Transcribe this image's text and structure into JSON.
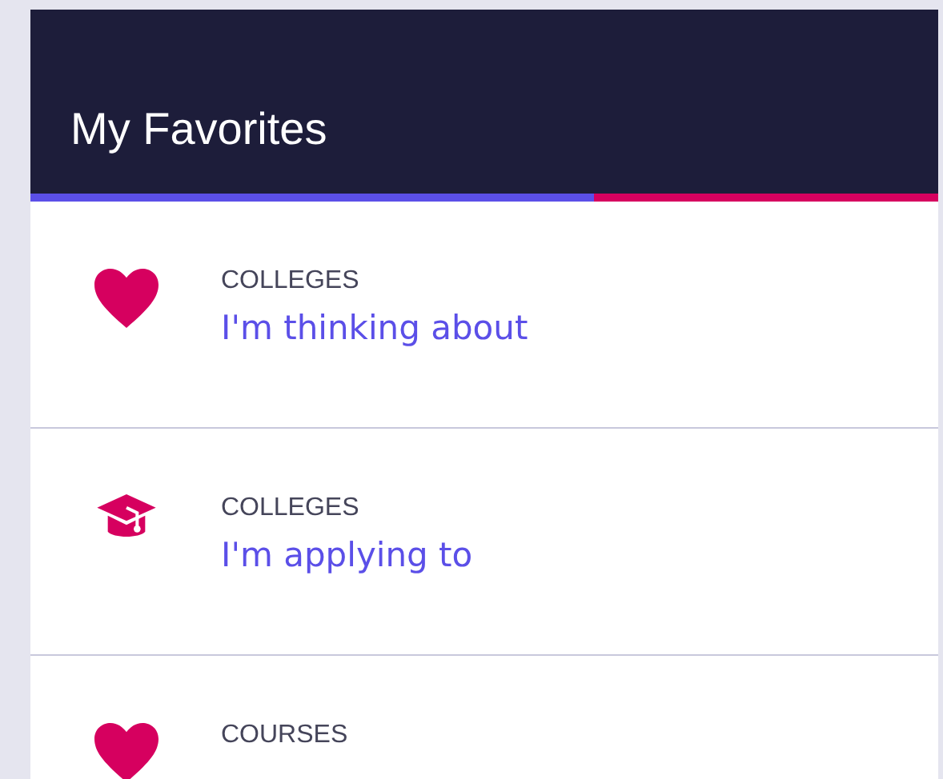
{
  "header": {
    "title": "My Favorites",
    "progress": {
      "level": 0.62
    }
  },
  "items": [
    {
      "kind": "heart",
      "category": "COLLEGES",
      "link": "I'm thinking about"
    },
    {
      "kind": "graduation-cap",
      "category": "COLLEGES",
      "link": "I'm applying to"
    },
    {
      "kind": "heart",
      "category": "COURSES"
    }
  ]
}
